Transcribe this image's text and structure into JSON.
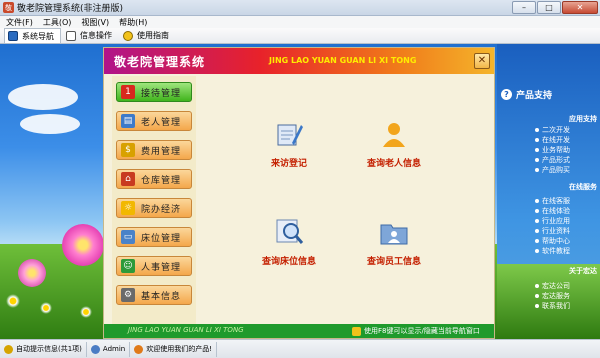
{
  "window": {
    "title": "敬老院管理系统(非注册版)",
    "min": "–",
    "max": "□",
    "close": "✕"
  },
  "menu": [
    "文件(F)",
    "工具(O)",
    "视图(V)",
    "帮助(H)"
  ],
  "tabs": [
    {
      "label": "系统导航",
      "active": true
    },
    {
      "label": "信息操作",
      "active": false
    },
    {
      "label": "使用指南",
      "active": false
    }
  ],
  "main": {
    "title": "敬老院管理系统",
    "subtitle": "JING LAO YUAN GUAN LI XI TONG",
    "close_glyph": "✕"
  },
  "nav": [
    {
      "label": "接待管理",
      "icon": "reception-icon",
      "active": true
    },
    {
      "label": "老人管理",
      "icon": "elder-card-icon",
      "active": false
    },
    {
      "label": "费用管理",
      "icon": "coins-icon",
      "active": false
    },
    {
      "label": "仓库管理",
      "icon": "house-icon",
      "active": false
    },
    {
      "label": "院办经济",
      "icon": "sun-icon",
      "active": false
    },
    {
      "label": "床位管理",
      "icon": "bed-icon",
      "active": false
    },
    {
      "label": "人事管理",
      "icon": "people-icon",
      "active": false
    },
    {
      "label": "基本信息",
      "icon": "gear-icon",
      "active": false
    }
  ],
  "features": [
    {
      "label": "来访登记",
      "icon": "register-pen-icon"
    },
    {
      "label": "查询老人信息",
      "icon": "person-search-icon"
    },
    {
      "label": "查询床位信息",
      "icon": "magnifier-icon"
    },
    {
      "label": "查询员工信息",
      "icon": "folder-person-icon"
    }
  ],
  "footer": {
    "left_text": "JING LAO YUAN GUAN LI XI TONG",
    "right_text": "使用F8键可以显示/隐藏当前导航窗口"
  },
  "right_panel": {
    "heading": "产品支持",
    "sections": [
      {
        "title": "应用支持",
        "links": [
          "二次开发",
          "在线开发",
          "业务帮助",
          "产品形式",
          "产品购买"
        ]
      },
      {
        "title": "在线服务",
        "links": [
          "在线客服",
          "在线体验",
          "行业应用",
          "行业资料",
          "帮助中心",
          "软件教程"
        ]
      },
      {
        "title": "关于宏达",
        "links": [
          "宏达公司",
          "宏达服务",
          "联系我们"
        ]
      }
    ]
  },
  "status": {
    "auto_tip": "自动提示信息(共1项)",
    "user": "Admin",
    "welcome": "欢迎使用我们的产品!"
  },
  "colors": {
    "accent_green": "#40b41c",
    "nav_orange": "#f4a74b",
    "header_red": "#e8222a",
    "feature_red": "#c42000"
  }
}
